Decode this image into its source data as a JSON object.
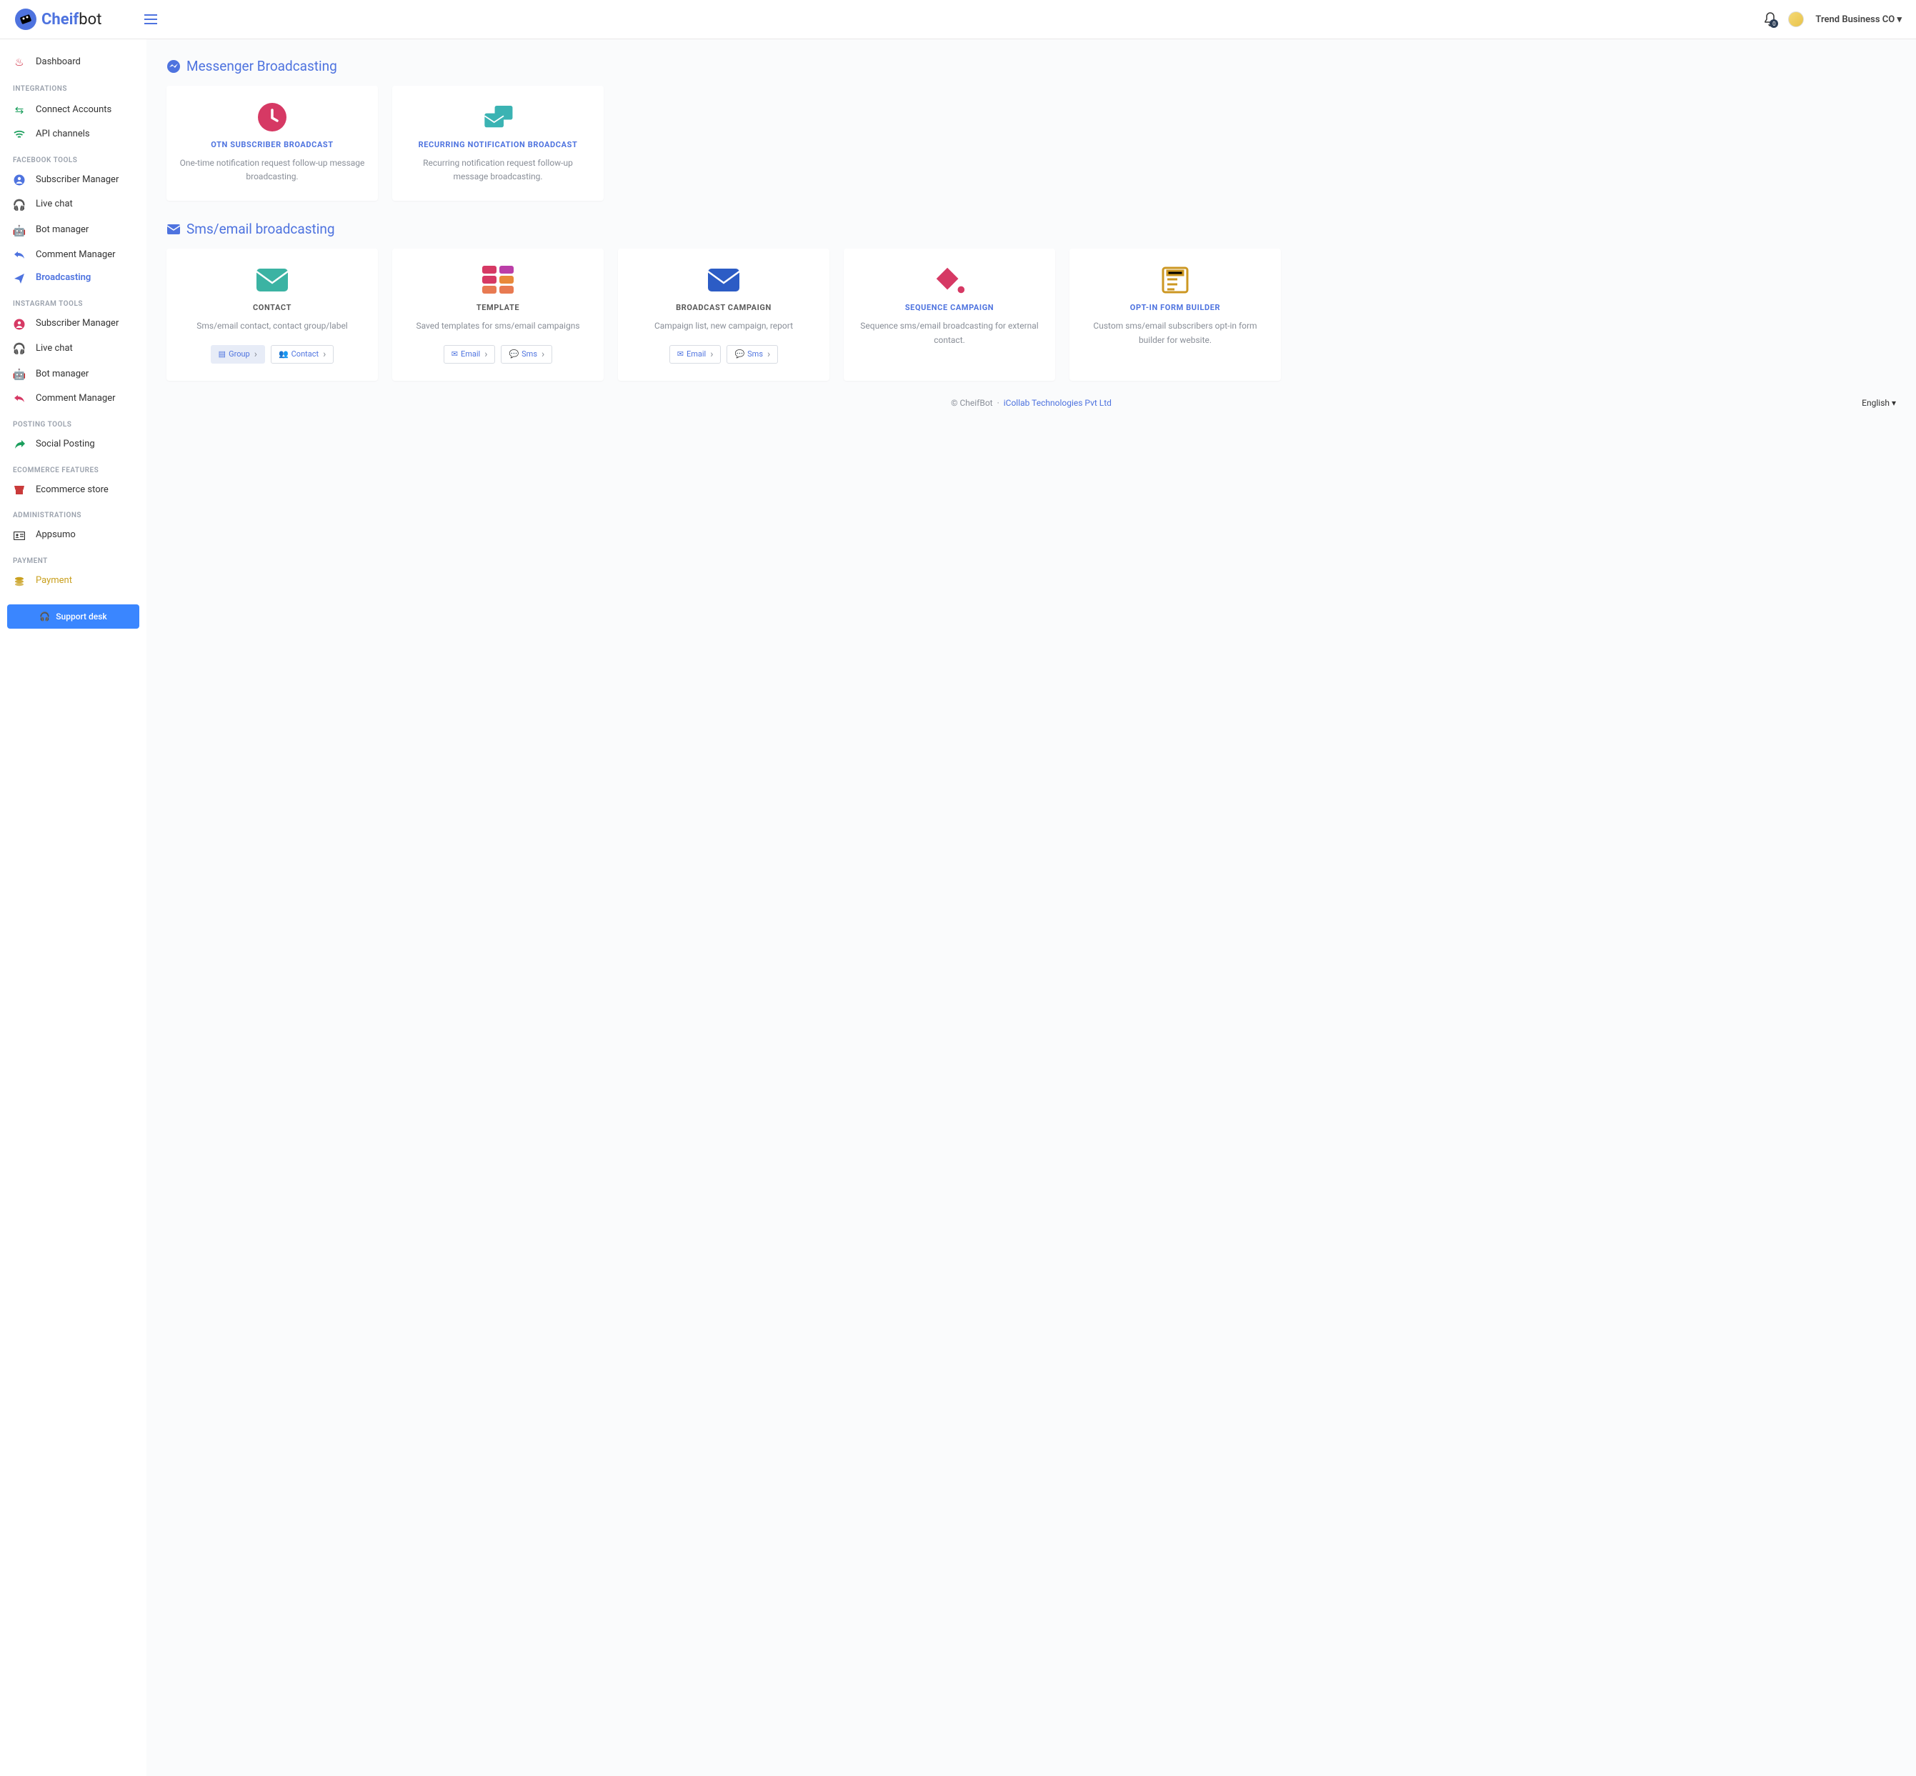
{
  "brand": {
    "name1": "Cheif",
    "name2": "bot"
  },
  "header": {
    "notif_count": "0",
    "user": "Trend Business CO"
  },
  "sidebar": {
    "dashboard": "Dashboard",
    "h_integrations": "INTEGRATIONS",
    "connect": "Connect Accounts",
    "api": "API channels",
    "h_fb": "FACEBOOK TOOLS",
    "fb_sub": "Subscriber Manager",
    "fb_live": "Live chat",
    "fb_bot": "Bot manager",
    "fb_comment": "Comment Manager",
    "fb_broadcast": "Broadcasting",
    "h_ig": "INSTAGRAM TOOLS",
    "ig_sub": "Subscriber Manager",
    "ig_live": "Live chat",
    "ig_bot": "Bot manager",
    "ig_comment": "Comment Manager",
    "h_posting": "POSTING TOOLS",
    "social": "Social Posting",
    "h_ecom": "ECOMMERCE FEATURES",
    "ecom": "Ecommerce store",
    "h_admin": "ADMINISTRATIONS",
    "appsumo": "Appsumo",
    "h_payment": "PAYMENT",
    "payment": "Payment",
    "support": "Support desk"
  },
  "sections": {
    "messenger": "Messenger Broadcasting",
    "sms": "Sms/email broadcasting"
  },
  "cards": {
    "otn": {
      "title": "OTN SUBSCRIBER BROADCAST",
      "desc": "One-time notification request follow-up message broadcasting."
    },
    "recurring": {
      "title": "RECURRING NOTIFICATION BROADCAST",
      "desc": "Recurring notification request follow-up message broadcasting."
    },
    "contact": {
      "title": "CONTACT",
      "desc": "Sms/email contact, contact group/label",
      "btn1": "Group",
      "btn2": "Contact"
    },
    "template": {
      "title": "TEMPLATE",
      "desc": "Saved templates for sms/email campaigns",
      "btn1": "Email",
      "btn2": "Sms"
    },
    "campaign": {
      "title": "BROADCAST CAMPAIGN",
      "desc": "Campaign list, new campaign, report",
      "btn1": "Email",
      "btn2": "Sms"
    },
    "sequence": {
      "title": "SEQUENCE CAMPAIGN",
      "desc": "Sequence sms/email broadcasting for external contact."
    },
    "optin": {
      "title": "OPT-IN FORM BUILDER",
      "desc": "Custom sms/email subscribers opt-in form builder for website."
    }
  },
  "footer": {
    "copy": "© CheifBot",
    "dot": "·",
    "company": "iCollab Technologies Pvt Ltd",
    "lang": "English"
  }
}
